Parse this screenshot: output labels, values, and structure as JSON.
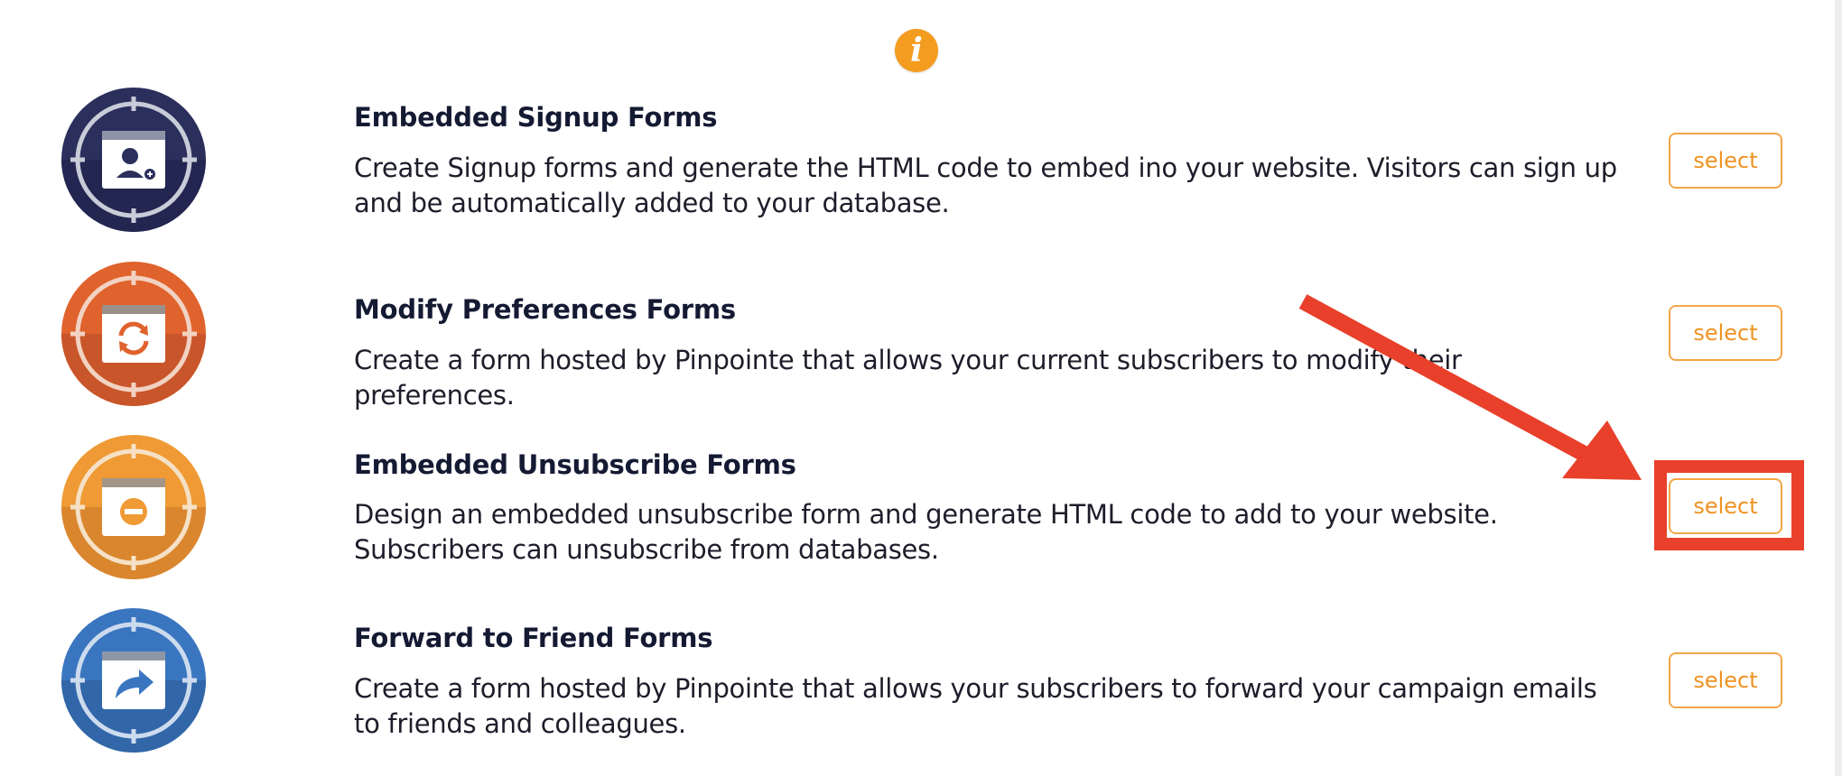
{
  "info_icon": {
    "glyph": "i",
    "color": "#f39c1f"
  },
  "rows": [
    {
      "title": "Embedded Signup Forms",
      "description": "Create Signup forms and generate the HTML code to embed ino your website. Visitors can sign up and be automatically added to your database.",
      "button_label": "select",
      "icon": "add-user-icon",
      "color": "#2a2f5c"
    },
    {
      "title": "Modify Preferences Forms",
      "description": "Create a form hosted by Pinpointe that allows your current subscribers to modify their preferences.",
      "button_label": "select",
      "icon": "refresh-icon",
      "color": "#e0622c"
    },
    {
      "title": "Embedded Unsubscribe Forms",
      "description": "Design an embedded unsubscribe form and generate HTML code to add to your website. Subscribers can unsubscribe from databases.",
      "button_label": "select",
      "icon": "minus-circle-icon",
      "color": "#ef9a34"
    },
    {
      "title": "Forward to Friend Forms",
      "description": "Create a form hosted by Pinpointe that allows your subscribers to forward your campaign emails to friends and colleagues.",
      "button_label": "select",
      "icon": "share-arrow-icon",
      "color": "#3a76c0"
    }
  ],
  "annotation": {
    "color": "#e8402a",
    "target": "Embedded Unsubscribe Forms select button"
  }
}
